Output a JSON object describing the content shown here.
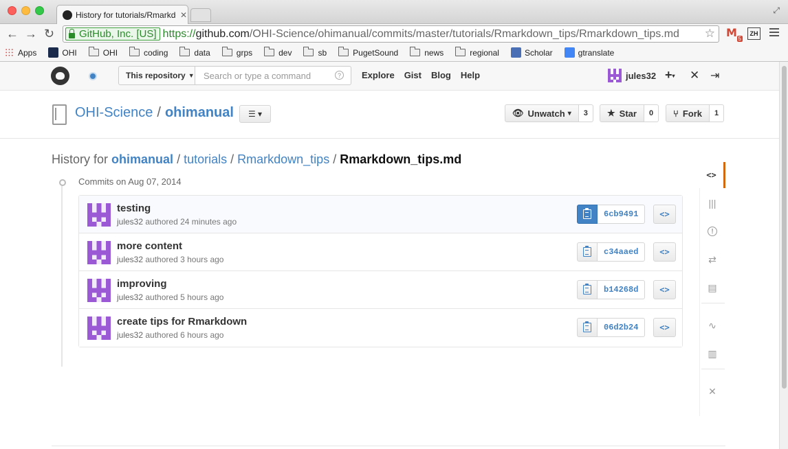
{
  "browser": {
    "tab_title": "History for tutorials/Rmarkdown_tips/Rmarkdown_tips.md",
    "ev_cert": "GitHub, Inc. [US]",
    "url_scheme": "https://",
    "url_host": "github.com",
    "url_path": "/OHI-Science/ohimanual/commits/master/tutorials/Rmarkdown_tips/Rmarkdown_tips.md",
    "gmail_badge": "5",
    "zh_ext": "ZH",
    "bookmarks": [
      {
        "label": "Apps",
        "icon": "apps-grid-icon"
      },
      {
        "label": "OHI",
        "icon": "ohi-logo-icon"
      },
      {
        "label": "OHI",
        "icon": "folder-icon"
      },
      {
        "label": "coding",
        "icon": "folder-icon"
      },
      {
        "label": "data",
        "icon": "folder-icon"
      },
      {
        "label": "grps",
        "icon": "folder-icon"
      },
      {
        "label": "dev",
        "icon": "folder-icon"
      },
      {
        "label": "sb",
        "icon": "folder-icon"
      },
      {
        "label": "PugetSound",
        "icon": "folder-icon"
      },
      {
        "label": "news",
        "icon": "folder-icon"
      },
      {
        "label": "regional",
        "icon": "folder-icon"
      },
      {
        "label": "Scholar",
        "icon": "scholar-icon"
      },
      {
        "label": "gtranslate",
        "icon": "translate-icon"
      }
    ]
  },
  "header": {
    "scope_label": "This repository",
    "search_placeholder": "Search or type a command",
    "nav": [
      "Explore",
      "Gist",
      "Blog",
      "Help"
    ],
    "username": "jules32"
  },
  "repo": {
    "owner": "OHI-Science",
    "separator": "/",
    "name": "ohimanual",
    "actions": [
      {
        "label": "Unwatch",
        "count": "3",
        "icon": "eye-icon",
        "caret": true
      },
      {
        "label": "Star",
        "count": "0",
        "icon": "star-icon",
        "caret": false
      },
      {
        "label": "Fork",
        "count": "1",
        "icon": "fork-icon",
        "caret": false
      }
    ]
  },
  "history": {
    "prefix": "History for",
    "path": [
      "ohimanual",
      "tutorials",
      "Rmarkdown_tips"
    ],
    "file": "Rmarkdown_tips.md",
    "date_heading": "Commits on Aug 07, 2014"
  },
  "commits": [
    {
      "message": "testing",
      "author": "jules32",
      "verb": "authored",
      "time": "24 minutes ago",
      "sha": "6cb9491"
    },
    {
      "message": "more content",
      "author": "jules32",
      "verb": "authored",
      "time": "3 hours ago",
      "sha": "c34aaed"
    },
    {
      "message": "improving",
      "author": "jules32",
      "verb": "authored",
      "time": "5 hours ago",
      "sha": "b14268d"
    },
    {
      "message": "create tips for Rmarkdown",
      "author": "jules32",
      "verb": "authored",
      "time": "6 hours ago",
      "sha": "06d2b24"
    }
  ],
  "browse_label": "<>",
  "colors": {
    "link": "#4183c4",
    "avatar": "#9b59d6",
    "sidebar_accent": "#d26911"
  },
  "sidebar": [
    {
      "name": "code",
      "icon": "code-icon",
      "glyph": "<>"
    },
    {
      "name": "issues",
      "icon": "issues-icon",
      "glyph": "!"
    },
    {
      "name": "pull-requests",
      "icon": "pull-request-icon",
      "glyph": "⇄"
    },
    {
      "name": "wiki",
      "icon": "book-icon",
      "glyph": "▤"
    },
    {
      "name": "pulse",
      "icon": "pulse-icon",
      "glyph": "∿"
    },
    {
      "name": "graphs",
      "icon": "graph-icon",
      "glyph": "▥"
    },
    {
      "name": "settings",
      "icon": "tools-icon",
      "glyph": "✕"
    }
  ]
}
